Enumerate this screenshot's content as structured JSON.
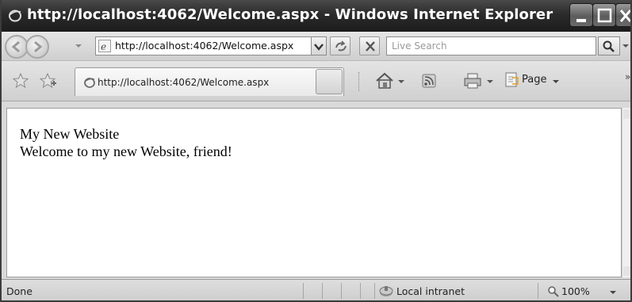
{
  "window": {
    "title": "http://localhost:4062/Welcome.aspx - Windows Internet Explorer"
  },
  "address_bar": {
    "url": "http://localhost:4062/Welcome.aspx"
  },
  "search": {
    "placeholder": "Live Search"
  },
  "tab": {
    "title": "http://localhost:4062/Welcome.aspx"
  },
  "command_bar": {
    "page_label": "Page"
  },
  "page": {
    "heading": "My New Website",
    "welcome": "Welcome to my new Website, friend!"
  },
  "status_bar": {
    "status": "Done",
    "zone": "Local intranet",
    "zoom": "100%"
  },
  "icons": {
    "ie": "ie-logo-icon",
    "back": "back-arrow-icon",
    "forward": "forward-arrow-icon",
    "refresh": "refresh-icon",
    "stop": "stop-icon",
    "search": "magnifier-icon",
    "favorites": "favorites-star-icon",
    "add_favorite": "add-favorite-icon",
    "home": "home-icon",
    "feeds": "rss-feeds-icon",
    "print": "printer-icon",
    "page": "page-icon",
    "zone": "intranet-zone-icon",
    "zoom": "zoom-magnifier-icon"
  }
}
